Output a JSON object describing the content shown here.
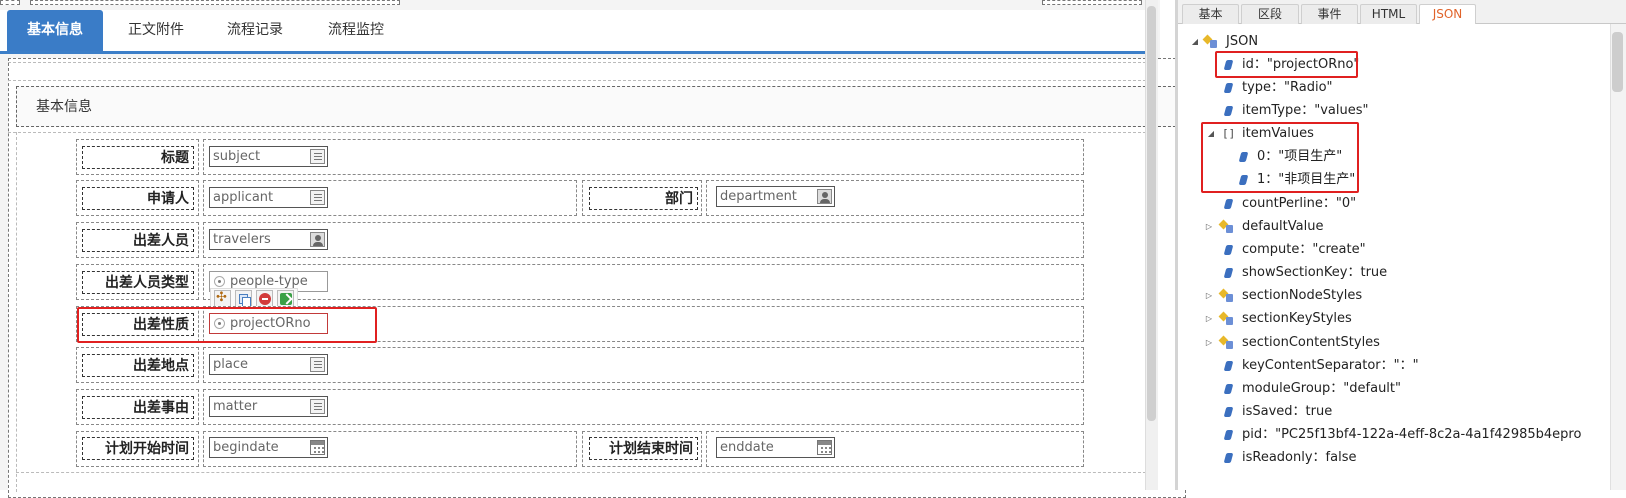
{
  "designer": {
    "tabs": [
      {
        "label": "基本信息"
      },
      {
        "label": "正文附件"
      },
      {
        "label": "流程记录"
      },
      {
        "label": "流程监控"
      }
    ],
    "section_title": "基本信息",
    "rows": {
      "subject": {
        "label": "标题",
        "value": "subject"
      },
      "applicant": {
        "label": "申请人",
        "value": "applicant"
      },
      "department": {
        "label": "部门",
        "value": "department"
      },
      "travelers": {
        "label": "出差人员",
        "value": "travelers"
      },
      "people_type": {
        "label": "出差人员类型",
        "value": "people-type"
      },
      "project": {
        "label": "出差性质",
        "value": "projectORno"
      },
      "place": {
        "label": "出差地点",
        "value": "place"
      },
      "matter": {
        "label": "出差事由",
        "value": "matter"
      },
      "begindate": {
        "label": "计划开始时间",
        "value": "begindate"
      },
      "enddate": {
        "label": "计划结束时间",
        "value": "enddate"
      }
    }
  },
  "inspector": {
    "tabs": [
      {
        "label": "基本"
      },
      {
        "label": "区段"
      },
      {
        "label": "事件"
      },
      {
        "label": "HTML"
      },
      {
        "label": "JSON"
      }
    ],
    "tree": [
      {
        "text": "JSON"
      },
      {
        "text": "id：\"projectORno\""
      },
      {
        "text": "type：\"Radio\""
      },
      {
        "text": "itemType：\"values\""
      },
      {
        "text": "itemValues"
      },
      {
        "text": "0：\"项目生产\""
      },
      {
        "text": "1：\"非项目生产\""
      },
      {
        "text": "countPerline：\"0\""
      },
      {
        "text": "defaultValue"
      },
      {
        "text": "compute：\"create\""
      },
      {
        "text": "showSectionKey：true"
      },
      {
        "text": "sectionNodeStyles"
      },
      {
        "text": "sectionKeyStyles"
      },
      {
        "text": "sectionContentStyles"
      },
      {
        "text": "keyContentSeparator：\"：\""
      },
      {
        "text": "moduleGroup：\"default\""
      },
      {
        "text": "isSaved：true"
      },
      {
        "text": "pid：\"PC25f13bf4-122a-4eff-8c2a-4a1f42985b4epro"
      },
      {
        "text": "isReadonly：false"
      }
    ]
  },
  "colors": {
    "accent": "#3a7cc7",
    "highlight": "#e02020",
    "json_tab": "#e0632a"
  }
}
